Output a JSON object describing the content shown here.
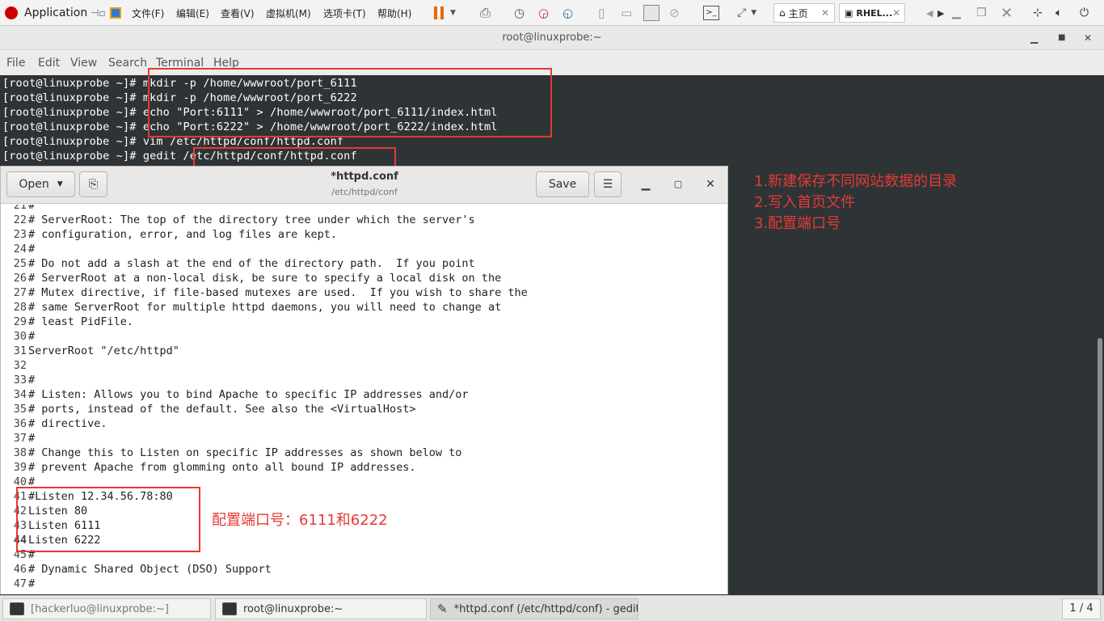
{
  "vmbar": {
    "applications": "Application",
    "menus": [
      "文件(F)",
      "编辑(E)",
      "查看(V)",
      "虚拟机(M)",
      "选项卡(T)",
      "帮助(H)"
    ],
    "tabs": [
      {
        "label": "主页"
      },
      {
        "label": "RHEL..."
      }
    ]
  },
  "terminal": {
    "title": "root@linuxprobe:~",
    "menu": [
      "File",
      "Edit",
      "View",
      "Search",
      "Terminal",
      "Help"
    ],
    "lines": [
      "[root@linuxprobe ~]# mkdir -p /home/wwwroot/port_6111",
      "[root@linuxprobe ~]# mkdir -p /home/wwwroot/port_6222",
      "[root@linuxprobe ~]# echo \"Port:6111\" > /home/wwwroot/port_6111/index.html",
      "[root@linuxprobe ~]# echo \"Port:6222\" > /home/wwwroot/port_6222/index.html",
      "[root@linuxprobe ~]# vim /etc/httpd/conf/httpd.conf",
      "[root@linuxprobe ~]# gedit /etc/httpd/conf/httpd.conf"
    ]
  },
  "gedit": {
    "open_label": "Open",
    "save_label": "Save",
    "title": "*httpd.conf",
    "path": "/etc/httpd/conf",
    "lines": [
      {
        "n": "21",
        "t": "#"
      },
      {
        "n": "22",
        "t": "# ServerRoot: The top of the directory tree under which the server's"
      },
      {
        "n": "23",
        "t": "# configuration, error, and log files are kept."
      },
      {
        "n": "24",
        "t": "#"
      },
      {
        "n": "25",
        "t": "# Do not add a slash at the end of the directory path.  If you point"
      },
      {
        "n": "26",
        "t": "# ServerRoot at a non-local disk, be sure to specify a local disk on the"
      },
      {
        "n": "27",
        "t": "# Mutex directive, if file-based mutexes are used.  If you wish to share the"
      },
      {
        "n": "28",
        "t": "# same ServerRoot for multiple httpd daemons, you will need to change at"
      },
      {
        "n": "29",
        "t": "# least PidFile."
      },
      {
        "n": "30",
        "t": "#"
      },
      {
        "n": "31",
        "t": "ServerRoot \"/etc/httpd\""
      },
      {
        "n": "32",
        "t": ""
      },
      {
        "n": "33",
        "t": "#"
      },
      {
        "n": "34",
        "t": "# Listen: Allows you to bind Apache to specific IP addresses and/or"
      },
      {
        "n": "35",
        "t": "# ports, instead of the default. See also the <VirtualHost>"
      },
      {
        "n": "36",
        "t": "# directive."
      },
      {
        "n": "37",
        "t": "#"
      },
      {
        "n": "38",
        "t": "# Change this to Listen on specific IP addresses as shown below to"
      },
      {
        "n": "39",
        "t": "# prevent Apache from glomming onto all bound IP addresses."
      },
      {
        "n": "40",
        "t": "#"
      },
      {
        "n": "41",
        "t": "#Listen 12.34.56.78:80"
      },
      {
        "n": "42",
        "t": "Listen 80"
      },
      {
        "n": "43",
        "t": "Listen 6111"
      },
      {
        "n": "44",
        "t": "Listen 6222"
      },
      {
        "n": "45",
        "t": "#"
      },
      {
        "n": "46",
        "t": "# Dynamic Shared Object (DSO) Support"
      },
      {
        "n": "47",
        "t": "#"
      }
    ]
  },
  "notes": {
    "steps": [
      "1.新建保存不同网站数据的目录",
      "2.写入首页文件",
      "3.配置端口号"
    ],
    "listen_note": "配置端口号：6111和6222"
  },
  "taskbar": {
    "items": [
      "[hackerluo@linuxprobe:~]",
      "root@linuxprobe:~",
      "*httpd.conf (/etc/httpd/conf) - gedit"
    ],
    "pager": "1 / 4"
  },
  "colors": {
    "annotation": "#e53935",
    "terminal_bg": "#2e3436"
  }
}
